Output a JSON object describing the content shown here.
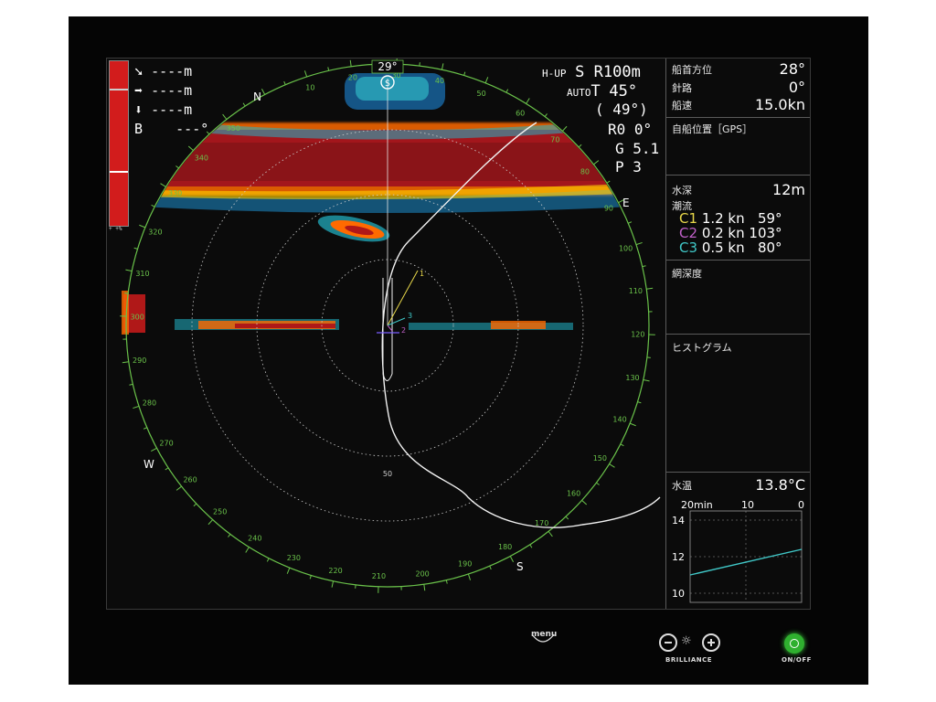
{
  "colors": {
    "echo_high": "#b01818",
    "echo_mid": "#ff6a00",
    "echo_low": "#22b5c8",
    "ring": "#6ac24a",
    "c1": "#e8d84a",
    "c2": "#c060c8",
    "c3": "#40c8c8"
  },
  "sonar": {
    "heading_box": "29°",
    "mode": "H-UP",
    "range_prefix": "S R",
    "range": "100m",
    "tilt_mode": "AUTO",
    "tilt_label": "T",
    "tilt": "45°",
    "tilt_sub": "( 49°)",
    "r_value": "R0 0°",
    "g_value": "G 5.1",
    "p_value": "P 3",
    "range_label_50": "50",
    "north": "N",
    "east": "E",
    "south": "S",
    "west": "W",
    "bearing_labels": [
      "10",
      "20",
      "30",
      "40",
      "50",
      "60",
      "70",
      "80",
      "90",
      "100",
      "110",
      "120",
      "130",
      "140",
      "150",
      "160",
      "170",
      "180",
      "190",
      "200",
      "210",
      "220",
      "230",
      "240",
      "250",
      "260",
      "270",
      "280",
      "290",
      "300",
      "310",
      "320",
      "330",
      "340",
      "350"
    ],
    "marker_1": "1",
    "marker_2": "2",
    "marker_3": "3",
    "left_readouts": [
      {
        "icon": "arrow-down-right-icon",
        "glyph": "➘",
        "text": "----m"
      },
      {
        "icon": "arrow-right-icon",
        "glyph": "➡",
        "text": "----m"
      },
      {
        "icon": "arrow-down-icon",
        "glyph": "⬇",
        "text": "----m"
      }
    ],
    "bearing_label": "B",
    "bearing_value": "---°",
    "gain_bar_caption": "+ +%"
  },
  "panel": {
    "heading": {
      "label": "船首方位",
      "value": "28°"
    },
    "course": {
      "label": "針路",
      "value": "0°"
    },
    "speed": {
      "label": "船速",
      "value": "15.0kn"
    },
    "position": {
      "label": "自船位置［GPS］"
    },
    "depth": {
      "label": "水深",
      "value": "12m"
    },
    "current": {
      "label": "潮流",
      "rows": [
        {
          "tag": "C1",
          "speed": "1.2 kn",
          "dir": "59°"
        },
        {
          "tag": "C2",
          "speed": "0.2 kn",
          "dir": "103°"
        },
        {
          "tag": "C3",
          "speed": "0.5 kn",
          "dir": "80°"
        }
      ]
    },
    "net_depth": {
      "label": "網深度"
    },
    "histogram": {
      "label": "ヒストグラム"
    },
    "water_temp": {
      "label": "水温",
      "value": "13.8°C",
      "x_labels": [
        "20min",
        "10",
        "0"
      ],
      "y_labels": [
        "14",
        "12",
        "10"
      ]
    }
  },
  "hardware": {
    "menu": "menu",
    "brilliance": "BRILLIANCE",
    "onoff": "ON/OFF"
  },
  "chart_data": {
    "type": "line",
    "x": [
      20,
      0
    ],
    "y": [
      11.0,
      12.4
    ],
    "xlabel": "",
    "ylabel": "",
    "x_ticks": [
      "20min",
      "10",
      "0"
    ],
    "y_ticks": [
      "14",
      "12",
      "10"
    ],
    "xlim": [
      20,
      0
    ],
    "ylim": [
      9.5,
      14.5
    ],
    "series": [
      {
        "values": [
          11.0,
          12.4
        ]
      }
    ],
    "grid": true
  }
}
